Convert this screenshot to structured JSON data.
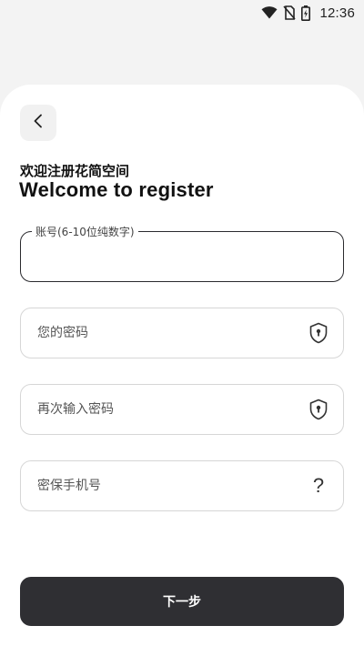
{
  "status_bar": {
    "time": "12:36",
    "icons": [
      "wifi-icon",
      "no-sim-icon",
      "battery-charging-icon"
    ]
  },
  "header": {
    "back_icon": "chevron-left-icon",
    "subtitle": "欢迎注册花简空间",
    "title": "Welcome to register"
  },
  "form": {
    "account": {
      "label": "账号(6-10位纯数字)",
      "value": "",
      "placeholder": ""
    },
    "password": {
      "placeholder": "您的密码",
      "icon": "shield-lock-icon"
    },
    "confirm_password": {
      "placeholder": "再次输入密码",
      "icon": "shield-lock-icon"
    },
    "phone": {
      "placeholder": "密保手机号",
      "icon": "question-mark-icon",
      "icon_glyph": "?"
    }
  },
  "actions": {
    "next_label": "下一步"
  },
  "colors": {
    "primary_button": "#2f2f33",
    "card": "#ffffff",
    "background": "#f3f3f3"
  }
}
